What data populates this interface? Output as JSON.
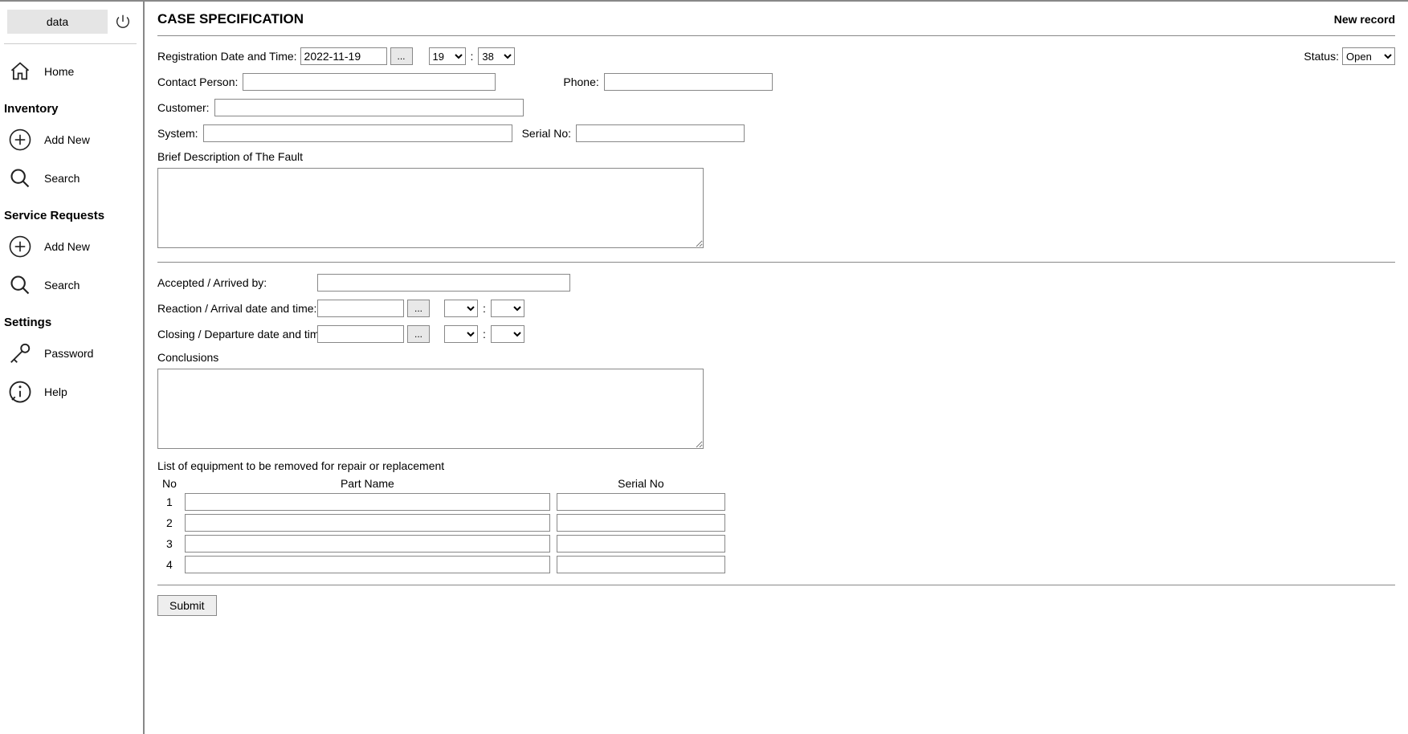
{
  "sidebar": {
    "data_btn": "data",
    "home": "Home",
    "section_inventory": "Inventory",
    "add_new": "Add New",
    "search": "Search",
    "section_service": "Service Requests",
    "section_settings": "Settings",
    "password": "Password",
    "help": "Help"
  },
  "header": {
    "title": "CASE SPECIFICATION",
    "new_record": "New record"
  },
  "form": {
    "reg_label": "Registration Date and Time:",
    "reg_date_value": "2022-11-19",
    "dots": "...",
    "hour_selected": "19",
    "minute_selected": "38",
    "status_label": "Status:",
    "status_value": "Open",
    "contact_label": "Contact Person:",
    "phone_label": "Phone:",
    "customer_label": "Customer:",
    "system_label": "System:",
    "serial_label": "Serial No:",
    "brief_label": "Brief Description of The Fault",
    "accepted_label": "Accepted / Arrived by:",
    "reaction_label": "Reaction / Arrival date and time:",
    "closing_label": "Closing / Departure date and time:",
    "conclusions_label": "Conclusions",
    "eq_title": "List of equipment to be removed for repair or replacement",
    "col_no": "No",
    "col_part": "Part Name",
    "col_serial": "Serial No",
    "rows": [
      "1",
      "2",
      "3",
      "4"
    ],
    "submit": "Submit"
  }
}
